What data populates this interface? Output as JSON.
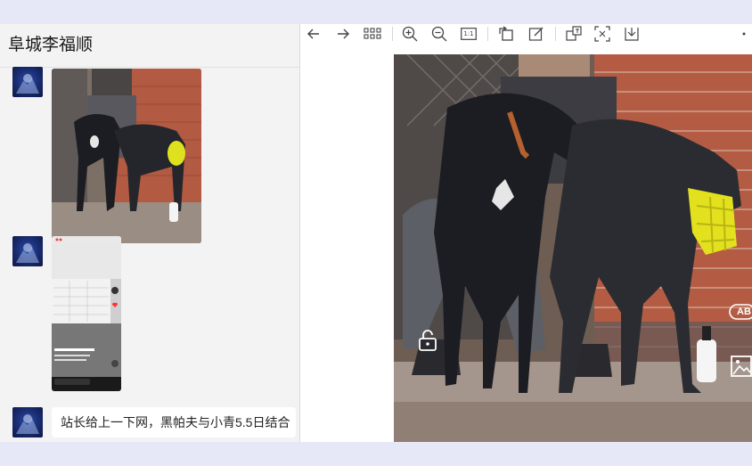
{
  "chat": {
    "title": "阜城李福顺",
    "messages": [
      {
        "type": "image",
        "description": "photo-dogs"
      },
      {
        "type": "image",
        "description": "phone-screenshot"
      },
      {
        "type": "text",
        "text": "站长给上一下网，黑帕夫与小青5.5日结合"
      }
    ]
  },
  "viewer": {
    "ocr_label": "AB",
    "toolbar": [
      "back-icon",
      "forward-icon",
      "grid-icon",
      "zoom-in-icon",
      "zoom-out-icon",
      "actual-size-icon",
      "rotate-icon",
      "edit-icon",
      "translate-icon",
      "scan-icon",
      "download-icon",
      "more-icon"
    ],
    "actual_size_label": "1:1"
  },
  "colors": {
    "background": "#e6e7f7",
    "chat_bg": "#f3f3f3",
    "muzzle_yellow": "#e3e11e",
    "brick": "#b55b42"
  }
}
